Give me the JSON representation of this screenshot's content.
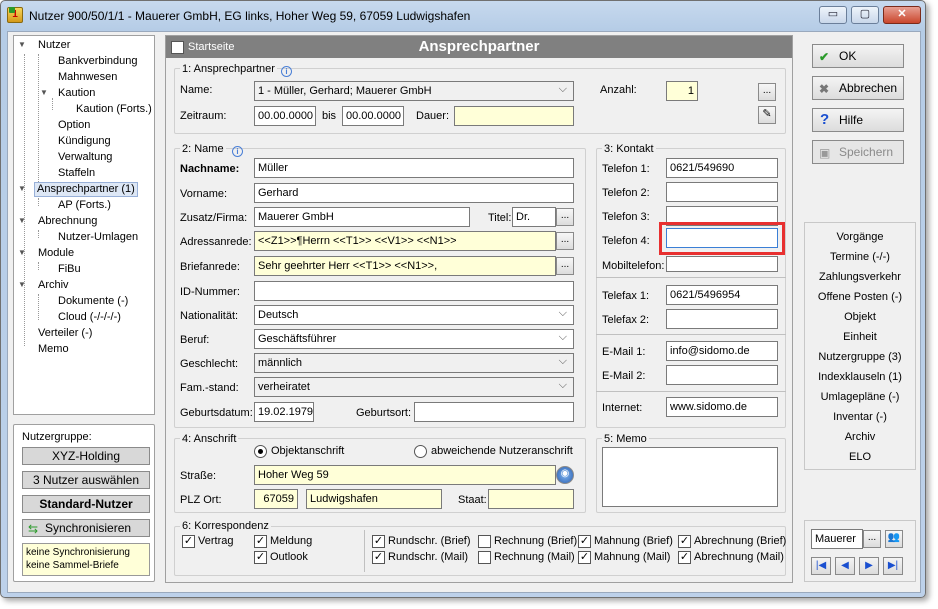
{
  "window": {
    "title": "Nutzer 900/50/1/1 - Mauerer GmbH, EG links, Hoher Weg 59, 67059 Ludwigshafen",
    "minimize": "▭",
    "maximize": "▢",
    "close": "✕"
  },
  "tree": {
    "items": [
      "Nutzer",
      "Bankverbindung",
      "Mahnwesen",
      "Kaution",
      "Kaution (Forts.)",
      "Option",
      "Kündigung",
      "Verwaltung",
      "Staffeln",
      "Ansprechpartner (1)",
      "AP (Forts.)",
      "Abrechnung",
      "Nutzer-Umlagen",
      "Module",
      "FiBu",
      "Archiv",
      "Dokumente (-)",
      "Cloud (-/-/-/-)",
      "Verteiler (-)",
      "Memo"
    ]
  },
  "group": {
    "label": "Nutzergruppe:",
    "holding": "XYZ-Holding",
    "select": "3 Nutzer auswählen",
    "standard": "Standard-Nutzer",
    "sync": "Synchronisieren",
    "note1": "keine Synchronisierung",
    "note2": "keine Sammel-Briefe"
  },
  "header": {
    "startseite": "Startseite",
    "title": "Ansprechpartner"
  },
  "sec1": {
    "title": "1: Ansprechpartner",
    "name_label": "Name:",
    "name_value": "1 - Müller, Gerhard; Mauerer GmbH",
    "zeitraum_label": "Zeitraum:",
    "from": "00.00.0000",
    "bis": "bis",
    "to": "00.00.0000",
    "dauer_label": "Dauer:",
    "dauer": "",
    "anzahl_label": "Anzahl:",
    "anzahl": "1",
    "ellipsis": "..."
  },
  "sec2": {
    "title": "2: Name",
    "nachname_label": "Nachname:",
    "nachname": "Müller",
    "vorname_label": "Vorname:",
    "vorname": "Gerhard",
    "zusatz_label": "Zusatz/Firma:",
    "zusatz": "Mauerer GmbH",
    "titel_label": "Titel:",
    "titel": "Dr.",
    "adress_label": "Adressanrede:",
    "adress": "<<Z1>>¶Herrn <<T1>> <<V1>> <<N1>>",
    "brief_label": "Briefanrede:",
    "brief": "Sehr geehrter Herr <<T1>> <<N1>>,",
    "id_label": "ID-Nummer:",
    "id": "",
    "nat_label": "Nationalität:",
    "nat": "Deutsch",
    "beruf_label": "Beruf:",
    "beruf": "Geschäftsführer",
    "geschl_label": "Geschlecht:",
    "geschl": "männlich",
    "fam_label": "Fam.-stand:",
    "fam": "verheiratet",
    "geb_label": "Geburtsdatum:",
    "geb": "19.02.1979",
    "ort_label": "Geburtsort:",
    "ort": ""
  },
  "sec3": {
    "title": "3: Kontakt",
    "tel1_label": "Telefon 1:",
    "tel1": "0621/549690",
    "tel2_label": "Telefon 2:",
    "tel2": "",
    "tel3_label": "Telefon 3:",
    "tel3": "",
    "tel4_label": "Telefon 4:",
    "tel4": "",
    "mobil_label": "Mobiltelefon:",
    "mobil": "",
    "fax1_label": "Telefax 1:",
    "fax1": "0621/5496954",
    "fax2_label": "Telefax 2:",
    "fax2": "",
    "mail1_label": "E-Mail 1:",
    "mail1": "info@sidomo.de",
    "mail2_label": "E-Mail 2:",
    "mail2": "",
    "inet_label": "Internet:",
    "inet": "www.sidomo.de"
  },
  "sec4": {
    "title": "4: Anschrift",
    "radio1": "Objektanschrift",
    "radio2": "abweichende Nutzeranschrift",
    "strasse_label": "Straße:",
    "strasse": "Hoher Weg 59",
    "plz_label": "PLZ Ort:",
    "plz": "67059",
    "ort": "Ludwigshafen",
    "staat_label": "Staat:",
    "staat": ""
  },
  "sec5": {
    "title": "5: Memo"
  },
  "sec6": {
    "title": "6: Korrespondenz",
    "vertrag": "Vertrag",
    "meldung": "Meldung",
    "outlook": "Outlook",
    "rb": "Rundschr. (Brief)",
    "rm": "Rundschr. (Mail)",
    "reb": "Rechnung (Brief)",
    "rem": "Rechnung (Mail)",
    "mb": "Mahnung (Brief)",
    "mm": "Mahnung (Mail)",
    "ab": "Abrechnung (Brief)",
    "am": "Abrechnung (Mail)",
    "check": "✓"
  },
  "actions": {
    "ok": "OK",
    "cancel": "Abbrechen",
    "help": "Hilfe",
    "save": "Speichern"
  },
  "links": [
    "Vorgänge",
    "Termine (-/-)",
    "Zahlungsverkehr",
    "Offene Posten (-)",
    "Objekt",
    "Einheit",
    "Nutzergruppe (3)",
    "Indexklauseln (1)",
    "Umlagepläne (-)",
    "Inventar (-)",
    "Archiv",
    "ELO"
  ],
  "search": {
    "value": "Mauerer",
    "ellipsis": "..."
  },
  "nav": {
    "first": "|◀",
    "prev": "◀",
    "next": "▶",
    "last": "▶|"
  },
  "colors": {
    "accent_red": "#e83030",
    "header_bg": "#7f7f7f"
  }
}
